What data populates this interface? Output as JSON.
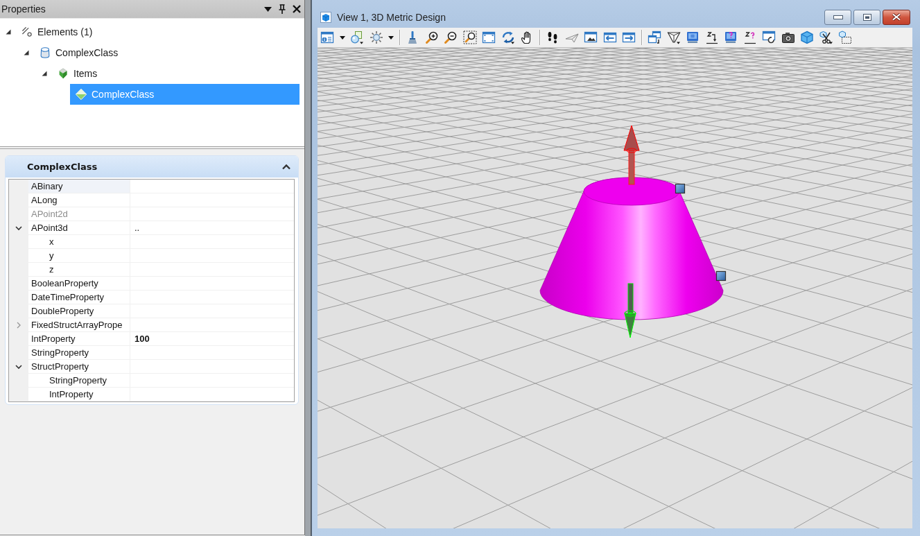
{
  "panel": {
    "title": "Properties"
  },
  "tree": [
    {
      "label": "Elements (1)",
      "kind": "elements",
      "expanded": true,
      "selected": false,
      "children": [
        {
          "label": "ComplexClass",
          "kind": "class",
          "expanded": true,
          "selected": false,
          "children": [
            {
              "label": "Items",
              "kind": "group",
              "expanded": true,
              "selected": false,
              "children": [
                {
                  "label": "ComplexClass",
                  "kind": "instance",
                  "selected": true
                }
              ]
            }
          ]
        }
      ]
    }
  ],
  "property_section": {
    "title": "ComplexClass",
    "expanded": true,
    "rows": [
      {
        "name": "ABinary",
        "selected": true,
        "disabled": false
      },
      {
        "name": "ALong",
        "selected": false,
        "disabled": false
      },
      {
        "name": "APoint2d",
        "selected": false,
        "disabled": true
      },
      {
        "name": "APoint3d",
        "value": "..",
        "selected": false,
        "disabled": false,
        "expanded": true,
        "children": [
          {
            "name": "x",
            "selected": false,
            "disabled": false
          },
          {
            "name": "y",
            "selected": false,
            "disabled": false
          },
          {
            "name": "z",
            "selected": false,
            "disabled": false
          }
        ]
      },
      {
        "name": "BooleanProperty",
        "selected": false,
        "disabled": false
      },
      {
        "name": "DateTimeProperty",
        "selected": false,
        "disabled": false
      },
      {
        "name": "DoubleProperty",
        "selected": false,
        "disabled": false
      },
      {
        "name": "FixedStructArrayPrope",
        "selected": false,
        "disabled": false,
        "expanded": false
      },
      {
        "name": "IntProperty",
        "value": "100",
        "selected": false,
        "disabled": false,
        "modified": true
      },
      {
        "name": "StringProperty",
        "selected": false,
        "disabled": false
      },
      {
        "name": "StructProperty",
        "selected": false,
        "disabled": false,
        "expanded": true,
        "children": [
          {
            "name": "StringProperty",
            "selected": false,
            "disabled": false
          },
          {
            "name": "IntProperty",
            "selected": false,
            "disabled": false
          }
        ]
      }
    ]
  },
  "view_window": {
    "title": "View 1, 3D Metric Design"
  }
}
